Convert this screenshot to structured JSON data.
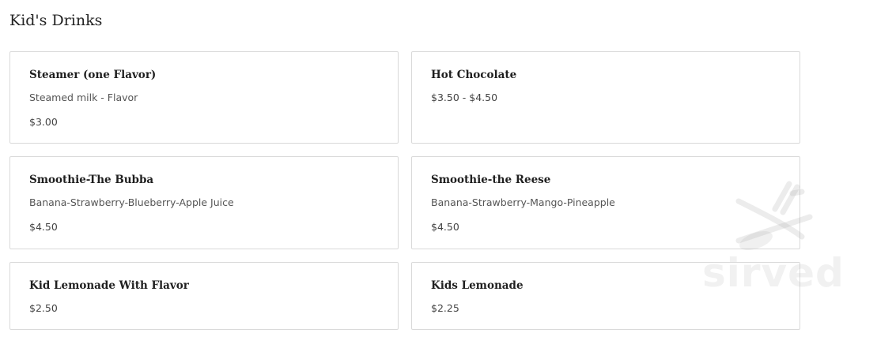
{
  "section": {
    "title": "Kid's Drinks"
  },
  "items": [
    {
      "name": "Steamer (one Flavor)",
      "description": "Steamed milk - Flavor",
      "price": "$3.00"
    },
    {
      "name": "Hot Chocolate",
      "description": "",
      "price": "$3.50 - $4.50"
    },
    {
      "name": "Smoothie-The Bubba",
      "description": "Banana-Strawberry-Blueberry-Apple Juice",
      "price": "$4.50"
    },
    {
      "name": "Smoothie-the Reese",
      "description": "Banana-Strawberry-Mango-Pineapple",
      "price": "$4.50"
    },
    {
      "name": "Kid Lemonade With Flavor",
      "description": "",
      "price": "$2.50"
    },
    {
      "name": "Kids Lemonade",
      "description": "",
      "price": "$2.25"
    }
  ],
  "watermark": {
    "text": "sirved"
  }
}
